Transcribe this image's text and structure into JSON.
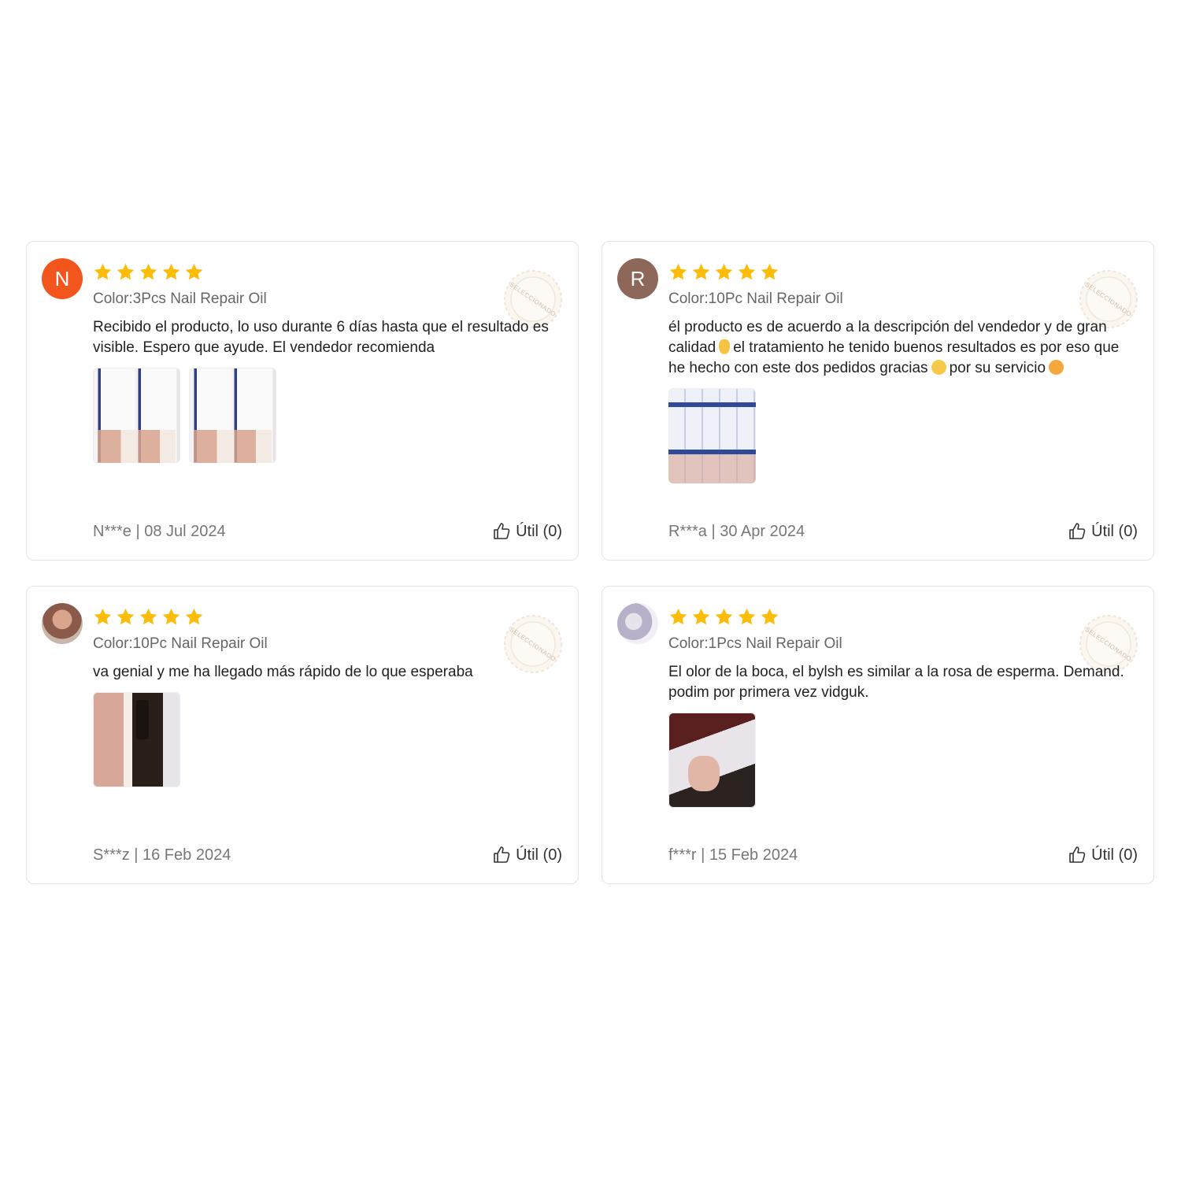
{
  "colors": {
    "star": "#fbbd0a",
    "avatar_n": "#f2561d",
    "avatar_r": "#8d675a",
    "border": "#e3e3e3"
  },
  "reviews": [
    {
      "avatar_letter": "N",
      "rating": 5,
      "variant": "Color:3Pcs Nail Repair Oil",
      "text": "Recibido el producto, lo uso durante 6 días hasta que el resultado es visible. Espero que ayude. El vendedor recomienda",
      "author_date": "N***e | 08 Jul 2024",
      "helpful": "Útil (0)",
      "seal": "SELECCIONADO"
    },
    {
      "avatar_letter": "R",
      "rating": 5,
      "variant": "Color:10Pc Nail Repair Oil",
      "text_part1": "él producto es de acuerdo a la descripción del vendedor y de gran calidad",
      "text_part2": "el tratamiento he tenido buenos resultados es por eso que he hecho con este dos pedidos gracias",
      "text_part3": "por su servicio",
      "author_date": "R***a | 30 Apr 2024",
      "helpful": "Útil (0)",
      "seal": "SELECCIONADO"
    },
    {
      "rating": 5,
      "variant": "Color:10Pc Nail Repair Oil",
      "text": "va genial y me ha llegado más rápido de lo que esperaba",
      "author_date": "S***z | 16 Feb 2024",
      "helpful": "Útil (0)",
      "seal": "SELECCIONADO"
    },
    {
      "rating": 5,
      "variant": "Color:1Pcs Nail Repair Oil",
      "text": "El olor de la boca, el bylsh es similar a la rosa de esperma. Demand. podim por primera vez vidguk.",
      "author_date": "f***r | 15 Feb 2024",
      "helpful": "Útil (0)",
      "seal": "SELECCIONADO"
    }
  ]
}
